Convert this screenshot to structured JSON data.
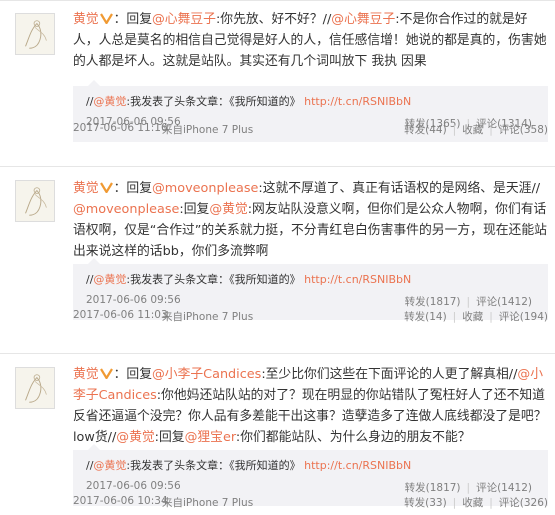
{
  "colors": {
    "link": "#eb7350",
    "meta": "#808080",
    "quote_bg": "#f2f2f5"
  },
  "posts": [
    {
      "author": "黄觉",
      "parts": [
        {
          "t": "：回复"
        },
        {
          "a": "@心舞豆子"
        },
        {
          "t": ":你先放、好不好？//"
        },
        {
          "a": "@心舞豆子"
        },
        {
          "t": ":不是你合作过的就是好人，人总是莫名的相信自己觉得是好人的人，信任感信增！她说的都是真的，伤害她的人都是坏人。这就是站队。其实还有几个词叫放下 我执 因果"
        }
      ],
      "quote": {
        "prefix": "//",
        "mention": "@黄觉",
        "text": ":我发表了头条文章：《我所知道的》",
        "link": "http://t.cn/RSNIBbN",
        "time": "2017-06-06 09:56",
        "repost": "转发(1365)",
        "comment": "评论(1314)"
      },
      "time": "2017-06-06 11:16",
      "source": "来自iPhone 7 Plus",
      "repost": "转发(44)",
      "fav": "收藏",
      "comment": "评论(358)"
    },
    {
      "author": "黄觉",
      "parts": [
        {
          "t": "：回复"
        },
        {
          "a": "@moveonplease"
        },
        {
          "t": ":这就不厚道了、真正有话语权的是网络、是天涯//"
        },
        {
          "a": "@moveonplease"
        },
        {
          "t": ":回复"
        },
        {
          "a": "@黄觉"
        },
        {
          "t": ":网友站队没意义啊，但你们是公众人物啊，你们有话语权啊，仅是“合作过”的关系就力挺，不分青红皂白伤害事件的另一方，现在还能站出来说这样的话bb，你们多流弊啊"
        }
      ],
      "quote": {
        "prefix": "//",
        "mention": "@黄觉",
        "text": ":我发表了头条文章：《我所知道的》",
        "link": "http://t.cn/RSNIBbN",
        "time": "2017-06-06 09:56",
        "repost": "转发(1817)",
        "comment": "评论(1412)"
      },
      "time": "2017-06-06 11:03",
      "source": "来自iPhone 7 Plus",
      "repost": "转发(14)",
      "fav": "收藏",
      "comment": "评论(194)"
    },
    {
      "author": "黄觉",
      "parts": [
        {
          "t": "：回复"
        },
        {
          "a": "@小李子Candices"
        },
        {
          "t": ":至少比你们这些在下面评论的人更了解真相//"
        },
        {
          "a": "@小李子Candices"
        },
        {
          "t": ":你他妈还站队站的对了？现在明显的你站错队了冤枉好人了还不知道反省还逼逼个没完？你人品有多差能干出这事？造孽造多了连做人底线都没了是吧？low货//"
        },
        {
          "a": "@黄觉"
        },
        {
          "t": ":回复"
        },
        {
          "a": "@狸宝er"
        },
        {
          "t": ":你们都能站队、为什么身边的朋友不能？"
        }
      ],
      "quote": {
        "prefix": "//",
        "mention": "@黄觉",
        "text": ":我发表了头条文章：《我所知道的》",
        "link": "http://t.cn/RSNIBbN",
        "time": "2017-06-06 09:56",
        "repost": "转发(1817)",
        "comment": "评论(1412)"
      },
      "time": "2017-06-06 10:34",
      "source": "来自iPhone 7 Plus",
      "repost": "转发(33)",
      "fav": "收藏",
      "comment": "评论(326)"
    }
  ]
}
